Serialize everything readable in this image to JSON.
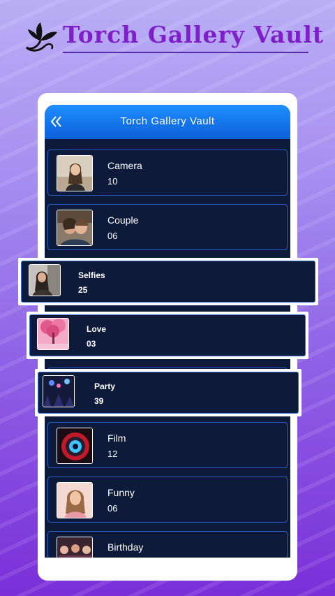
{
  "banner": {
    "title": "Torch Gallery Vault",
    "logo_icon": "flower-swirl-icon"
  },
  "appbar": {
    "title": "Torch Gallery Vault",
    "back_icon": "double-chevron-left-icon"
  },
  "colors": {
    "accent": "#1f8fff",
    "panel": "#0d1a3a",
    "border": "#2a5fc8",
    "banner_text": "#7f1fc9"
  },
  "albums": [
    {
      "name": "Camera",
      "count": "10",
      "thumb": "woman-portrait"
    },
    {
      "name": "Couple",
      "count": "06",
      "thumb": "couple-photo"
    },
    {
      "name": "Film",
      "count": "12",
      "thumb": "camera-lens"
    },
    {
      "name": "Funny",
      "count": "06",
      "thumb": "woman-portrait"
    },
    {
      "name": "Birthday",
      "count": "",
      "thumb": "party-crowd"
    }
  ],
  "popouts": [
    {
      "name": "Selfies",
      "count": "25",
      "thumb": "selfie-photo"
    },
    {
      "name": "Love",
      "count": "03",
      "thumb": "pink-tree"
    },
    {
      "name": "Party",
      "count": "39",
      "thumb": "party-crowd"
    }
  ]
}
